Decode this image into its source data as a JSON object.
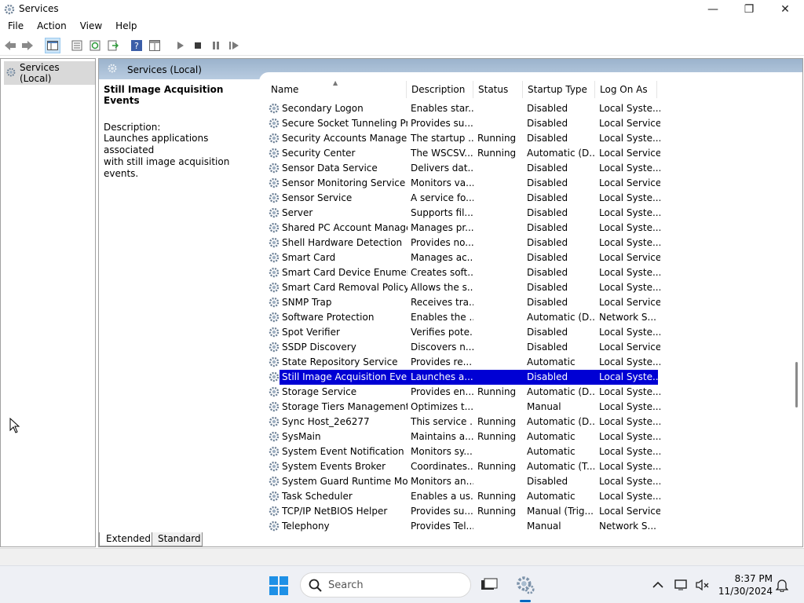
{
  "window": {
    "title": "Services",
    "controls": {
      "minimize": "—",
      "maximize": "❐",
      "close": "✕"
    }
  },
  "menu": [
    "File",
    "Action",
    "View",
    "Help"
  ],
  "tree": {
    "root_label": "Services (Local)"
  },
  "pane": {
    "header_title": "Services (Local)",
    "selected_title": "Still Image Acquisition Events",
    "description_label": "Description:",
    "description_lines": [
      "Launches applications associated",
      "with still image acquisition events."
    ]
  },
  "table": {
    "columns": [
      "Name",
      "Description",
      "Status",
      "Startup Type",
      "Log On As"
    ],
    "rows": [
      {
        "name": "Secondary Logon",
        "desc": "Enables star...",
        "status": "",
        "startup": "Disabled",
        "logon": "Local Syste..."
      },
      {
        "name": "Secure Socket Tunneling Pr...",
        "desc": "Provides su...",
        "status": "",
        "startup": "Disabled",
        "logon": "Local Service"
      },
      {
        "name": "Security Accounts Manager",
        "desc": "The startup ...",
        "status": "Running",
        "startup": "Disabled",
        "logon": "Local Syste..."
      },
      {
        "name": "Security Center",
        "desc": "The WSCSV...",
        "status": "Running",
        "startup": "Automatic (D...",
        "logon": "Local Service"
      },
      {
        "name": "Sensor Data Service",
        "desc": "Delivers dat...",
        "status": "",
        "startup": "Disabled",
        "logon": "Local Syste..."
      },
      {
        "name": "Sensor Monitoring Service",
        "desc": "Monitors va...",
        "status": "",
        "startup": "Disabled",
        "logon": "Local Service"
      },
      {
        "name": "Sensor Service",
        "desc": "A service fo...",
        "status": "",
        "startup": "Disabled",
        "logon": "Local Syste..."
      },
      {
        "name": "Server",
        "desc": "Supports fil...",
        "status": "",
        "startup": "Disabled",
        "logon": "Local Syste..."
      },
      {
        "name": "Shared PC Account Manager",
        "desc": "Manages pr...",
        "status": "",
        "startup": "Disabled",
        "logon": "Local Syste..."
      },
      {
        "name": "Shell Hardware Detection",
        "desc": "Provides no...",
        "status": "",
        "startup": "Disabled",
        "logon": "Local Syste..."
      },
      {
        "name": "Smart Card",
        "desc": "Manages ac...",
        "status": "",
        "startup": "Disabled",
        "logon": "Local Service"
      },
      {
        "name": "Smart Card Device Enumera...",
        "desc": "Creates soft...",
        "status": "",
        "startup": "Disabled",
        "logon": "Local Syste..."
      },
      {
        "name": "Smart Card Removal Policy",
        "desc": "Allows the s...",
        "status": "",
        "startup": "Disabled",
        "logon": "Local Syste..."
      },
      {
        "name": "SNMP Trap",
        "desc": "Receives tra...",
        "status": "",
        "startup": "Disabled",
        "logon": "Local Service"
      },
      {
        "name": "Software Protection",
        "desc": "Enables the ...",
        "status": "",
        "startup": "Automatic (D...",
        "logon": "Network S..."
      },
      {
        "name": "Spot Verifier",
        "desc": "Verifies pote...",
        "status": "",
        "startup": "Disabled",
        "logon": "Local Syste..."
      },
      {
        "name": "SSDP Discovery",
        "desc": "Discovers n...",
        "status": "",
        "startup": "Disabled",
        "logon": "Local Service"
      },
      {
        "name": "State Repository Service",
        "desc": "Provides re...",
        "status": "",
        "startup": "Automatic",
        "logon": "Local Syste..."
      },
      {
        "name": "Still Image Acquisition Events",
        "desc": "Launches a...",
        "status": "",
        "startup": "Disabled",
        "logon": "Local Syste...",
        "selected": true
      },
      {
        "name": "Storage Service",
        "desc": "Provides en...",
        "status": "Running",
        "startup": "Automatic (D...",
        "logon": "Local Syste..."
      },
      {
        "name": "Storage Tiers Management",
        "desc": "Optimizes t...",
        "status": "",
        "startup": "Manual",
        "logon": "Local Syste..."
      },
      {
        "name": "Sync Host_2e6277",
        "desc": "This service ...",
        "status": "Running",
        "startup": "Automatic (D...",
        "logon": "Local Syste..."
      },
      {
        "name": "SysMain",
        "desc": "Maintains a...",
        "status": "Running",
        "startup": "Automatic",
        "logon": "Local Syste..."
      },
      {
        "name": "System Event Notification S...",
        "desc": "Monitors sy...",
        "status": "",
        "startup": "Automatic",
        "logon": "Local Syste..."
      },
      {
        "name": "System Events Broker",
        "desc": "Coordinates...",
        "status": "Running",
        "startup": "Automatic (T...",
        "logon": "Local Syste..."
      },
      {
        "name": "System Guard Runtime Mo...",
        "desc": "Monitors an...",
        "status": "",
        "startup": "Disabled",
        "logon": "Local Syste..."
      },
      {
        "name": "Task Scheduler",
        "desc": "Enables a us...",
        "status": "Running",
        "startup": "Automatic",
        "logon": "Local Syste..."
      },
      {
        "name": "TCP/IP NetBIOS Helper",
        "desc": "Provides su...",
        "status": "Running",
        "startup": "Manual (Trig...",
        "logon": "Local Service"
      },
      {
        "name": "Telephony",
        "desc": "Provides Tel...",
        "status": "",
        "startup": "Manual",
        "logon": "Network S..."
      }
    ]
  },
  "tabs": [
    "Extended",
    "Standard"
  ],
  "taskbar": {
    "search_placeholder": "Search",
    "time": "8:37 PM",
    "date": "11/30/2024"
  },
  "colors": {
    "selection": "#0000d4",
    "header_gradient_top": "#9bb3cc",
    "taskbar_bg": "#eef0f5"
  }
}
